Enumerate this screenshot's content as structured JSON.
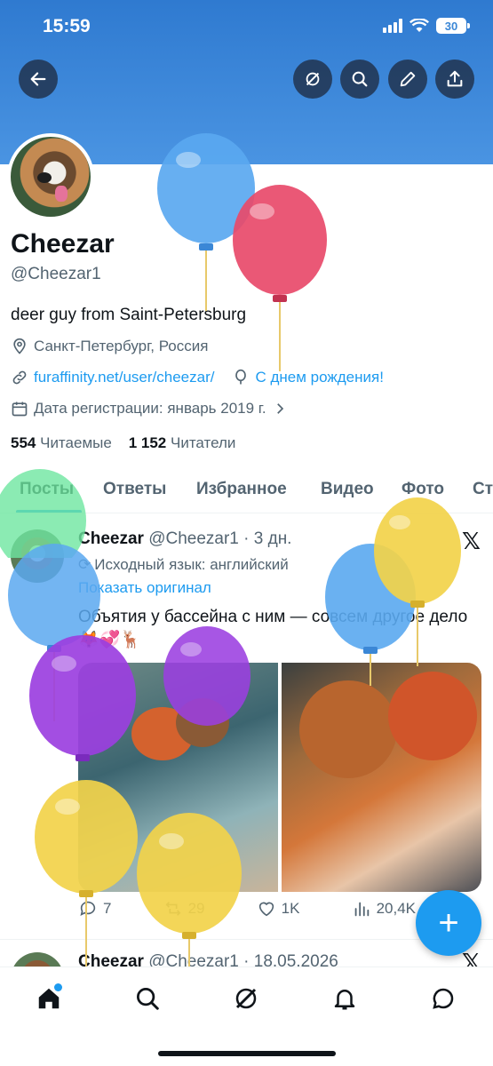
{
  "status_bar": {
    "time": "15:59",
    "battery": "30"
  },
  "profile": {
    "name": "Cheezar",
    "handle": "@Cheezar1",
    "bio": "deer guy from Saint-Petersburg",
    "location": "Санкт-Петербург, Россия",
    "website": "furaffinity.net/user/cheezar/",
    "birthday": "С днем рождения!",
    "joined": "Дата регистрации: январь 2019 г.",
    "following_count": "554",
    "following_label": "Читаемые",
    "followers_count": "1 152",
    "followers_label": "Читатели"
  },
  "tabs": [
    "Посты",
    "Ответы",
    "Избранное",
    "Видео",
    "Фото",
    "Ст"
  ],
  "post": {
    "author": "Cheezar",
    "meta": "@Cheezar1 · 3 дн.",
    "translation_note": "Исходный язык: английский",
    "show_original": "Показать оригинал",
    "text": "Объятия у бассейна с ним — совсем другое дело 🦊💞🦌",
    "replies": "7",
    "reposts": "29",
    "likes": "1K",
    "views": "20,4K"
  },
  "post2": {
    "author": "Cheezar",
    "meta": "@Cheezar1 · 18.05.2026"
  },
  "colors": {
    "accent": "#1d9bf0",
    "banner": "#3b87d6"
  }
}
